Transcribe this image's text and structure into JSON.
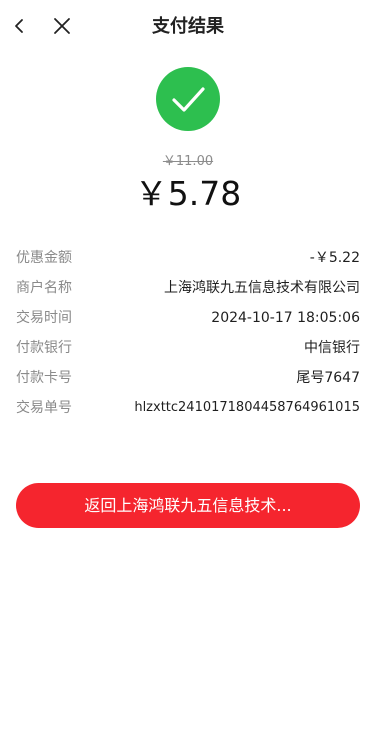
{
  "header": {
    "title": "支付结果"
  },
  "result": {
    "original_price": "￥11.00",
    "paid_amount": "￥5.78",
    "status_color": "#2dbf4f"
  },
  "details": [
    {
      "label": "优惠金额",
      "value": "-￥5.22"
    },
    {
      "label": "商户名称",
      "value": "上海鸿联九五信息技术有限公司"
    },
    {
      "label": "交易时间",
      "value": "2024-10-17 18:05:06"
    },
    {
      "label": "付款银行",
      "value": "中信银行"
    },
    {
      "label": "付款卡号",
      "value": "尾号7647"
    },
    {
      "label": "交易单号",
      "value": "hlzxttc2410171804458764961015"
    }
  ],
  "actions": {
    "return_label": "返回上海鸿联九五信息技术...",
    "accent_color": "#f5252e"
  },
  "icons": {
    "back": "chevron-left-icon",
    "close": "close-icon",
    "success": "check-circle-icon"
  }
}
